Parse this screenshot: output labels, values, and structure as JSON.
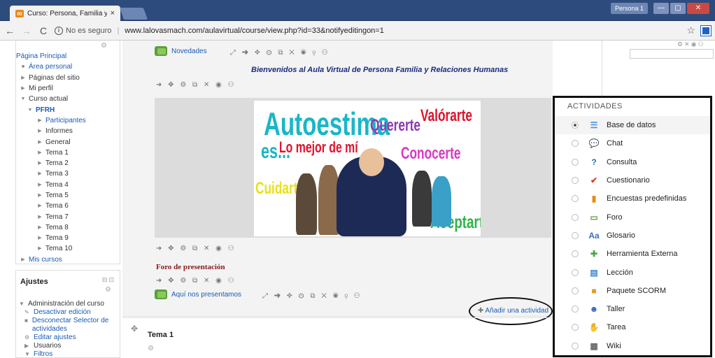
{
  "browser": {
    "tab_title": "Curso: Persona, Familia y",
    "tab_close": "×",
    "favicon_text": "m",
    "profile": "Persona 1",
    "window_controls": [
      "—",
      "▢",
      "✕"
    ],
    "security_label": "No es seguro",
    "url": "www.lalovasmach.com/aulavirtual/course/view.php?id=33&notifyeditingon=1"
  },
  "nav_block": {
    "items": [
      {
        "label": "Página Principal",
        "mark": "",
        "style": "link",
        "indent": 0
      },
      {
        "label": "Área personal",
        "mark": "■",
        "style": "link",
        "indent": 6
      },
      {
        "label": "Páginas del sitio",
        "mark": "▶",
        "style": "plain",
        "indent": 6
      },
      {
        "label": "Mi perfil",
        "mark": "▶",
        "style": "plain",
        "indent": 6
      },
      {
        "label": "Curso actual",
        "mark": "▼",
        "style": "plain",
        "indent": 6
      },
      {
        "label": "PFRH",
        "mark": "▼",
        "style": "bold",
        "indent": 16
      },
      {
        "label": "Participantes",
        "mark": "▶",
        "style": "link",
        "indent": 30
      },
      {
        "label": "Informes",
        "mark": "▶",
        "style": "plain",
        "indent": 30
      },
      {
        "label": "General",
        "mark": "▶",
        "style": "plain",
        "indent": 30
      },
      {
        "label": "Tema 1",
        "mark": "▶",
        "style": "plain",
        "indent": 30
      },
      {
        "label": "Tema 2",
        "mark": "▶",
        "style": "plain",
        "indent": 30
      },
      {
        "label": "Tema 3",
        "mark": "▶",
        "style": "plain",
        "indent": 30
      },
      {
        "label": "Tema 4",
        "mark": "▶",
        "style": "plain",
        "indent": 30
      },
      {
        "label": "Tema 5",
        "mark": "▶",
        "style": "plain",
        "indent": 30
      },
      {
        "label": "Tema 6",
        "mark": "▶",
        "style": "plain",
        "indent": 30
      },
      {
        "label": "Tema 7",
        "mark": "▶",
        "style": "plain",
        "indent": 30
      },
      {
        "label": "Tema 8",
        "mark": "▶",
        "style": "plain",
        "indent": 30
      },
      {
        "label": "Tema 9",
        "mark": "▶",
        "style": "plain",
        "indent": 30
      },
      {
        "label": "Tema 10",
        "mark": "▶",
        "style": "plain",
        "indent": 30
      },
      {
        "label": "Mis cursos",
        "mark": "▶",
        "style": "link",
        "indent": 6
      }
    ]
  },
  "ajustes_block": {
    "title": "Ajustes",
    "items": [
      {
        "label": "Administración del curso",
        "mark": "▼",
        "style": "plain",
        "indent": 0
      },
      {
        "label": "Desactivar edición",
        "mark": "✎",
        "style": "link",
        "indent": 8
      },
      {
        "label": "Desconectar Selector de actividades",
        "mark": "■",
        "style": "link",
        "indent": 8
      },
      {
        "label": "Editar ajustes",
        "mark": "⚙",
        "style": "link",
        "indent": 8
      },
      {
        "label": "Usuarios",
        "mark": "▶",
        "style": "plain",
        "indent": 8
      },
      {
        "label": "Filtros",
        "mark": "▼",
        "style": "link",
        "indent": 8
      }
    ]
  },
  "main": {
    "novedades": "Novedades",
    "welcome": "Bienvenidos al Aula Virtual de Persona Familia y Relaciones Humanas",
    "edit_icons_long": "⤢ ➜ ✥ ⚙ ⧉ ✕ ◉ ⚲ ⚇",
    "edit_icons_short": "➜ ✥ ⚙ ⧉ ✕ ◉ ⚇",
    "foro_title": "Foro de presentación",
    "aqui": "Aquí nos presentamos",
    "add_activity": "Añadir una actividad",
    "tema1": "Tema 1",
    "banner": {
      "autoestima": "Autoestima",
      "es": "es...",
      "lo_mejor": "Lo mejor de mí",
      "quererte": "Quererte",
      "valorarte": "Valórarte",
      "conocerte": "Conocerte",
      "cuidarte": "Cuidarte",
      "aceptarte": "Aceptarte"
    }
  },
  "actividades": {
    "title": "ACTIVIDADES",
    "items": [
      {
        "label": "Base de datos",
        "icon": "database-icon",
        "glyph": "☰",
        "color": "#4a90d9",
        "selected": true
      },
      {
        "label": "Chat",
        "icon": "chat-icon",
        "glyph": "💬",
        "color": "#f0a21e",
        "selected": false
      },
      {
        "label": "Consulta",
        "icon": "question-icon",
        "glyph": "?",
        "color": "#2b6cc4",
        "selected": false
      },
      {
        "label": "Cuestionario",
        "icon": "quiz-check-icon",
        "glyph": "✔",
        "color": "#d93b2b",
        "selected": false
      },
      {
        "label": "Encuestas predefinidas",
        "icon": "survey-chart-icon",
        "glyph": "▮",
        "color": "#e88a1a",
        "selected": false
      },
      {
        "label": "Foro",
        "icon": "forum-icon",
        "glyph": "▭",
        "color": "#5aa03b",
        "selected": false
      },
      {
        "label": "Glosario",
        "icon": "glossary-icon",
        "glyph": "Aa",
        "color": "#3a6fc0",
        "selected": false
      },
      {
        "label": "Herramienta Externa",
        "icon": "puzzle-icon",
        "glyph": "✚",
        "color": "#4aa84a",
        "selected": false
      },
      {
        "label": "Lección",
        "icon": "lesson-icon",
        "glyph": "▤",
        "color": "#3a8ad6",
        "selected": false
      },
      {
        "label": "Paquete SCORM",
        "icon": "scorm-package-icon",
        "glyph": "■",
        "color": "#e89a1e",
        "selected": false
      },
      {
        "label": "Taller",
        "icon": "workshop-people-icon",
        "glyph": "☻",
        "color": "#3b5fbf",
        "selected": false
      },
      {
        "label": "Tarea",
        "icon": "assignment-hand-icon",
        "glyph": "✋",
        "color": "#6aa0d8",
        "selected": false
      },
      {
        "label": "Wiki",
        "icon": "wiki-icon",
        "glyph": "▦",
        "color": "#666666",
        "selected": false
      }
    ]
  }
}
